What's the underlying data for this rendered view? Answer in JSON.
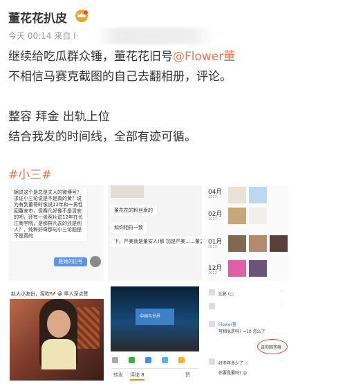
{
  "post": {
    "username": "董花花扒皮",
    "time": "今天 00:14",
    "source_prefix": "来自 I·",
    "lines": [
      "继续给吃瓜群众锤，董花花旧号",
      "不相信马赛克截图的自己去翻相册，评论。",
      "整容  拜金  出轨上位",
      "结合我发的时间线，全部有迹可循。"
    ],
    "mention": "@Flower董",
    "hashtag": "#小三#"
  },
  "images": {
    "chat": {
      "bubble_text": "据说这个是总是夫人的微博号？求证小三论说是不是真的黄？说为有到董哥时像说12年和一男性回董安市，但赛凡好像不是清安的吧，还有一张照片说12年在长江商学院，是那群凡去的还是别人？，纯粹好奇那句小三论题是不是真的",
      "reply": "是她的旧号"
    },
    "tile2": {
      "chip1": "董花花的粉丝发的",
      "chip2": "和你相符一致",
      "chip3": "下。严美就是董安人!那 加是严美……董之的"
    },
    "album": {
      "months": [
        "04月",
        "02月",
        "01月",
        "12月"
      ],
      "years": [
        "2013",
        "2013",
        "2013",
        "2012"
      ]
    },
    "photo_caption": "赵大小友份，挥吹🐶 😀 早人深点赞",
    "conference": {
      "screen_text": "中国与世界",
      "tabs": [
        "转发",
        "评论 8",
        "赞"
      ]
    },
    "comments": {
      "names": [
        "Flower董"
      ],
      "highlight": "该你回答哦",
      "texts": [
        "比影 (▢",
        "可相似是吗? ≈10 怎么了",
        "好多年多少了 ♡",
        "你要是要吗? ☺"
      ]
    }
  },
  "colors": {
    "accent": "#eb7350",
    "link": "#eb7350",
    "reply_bubble": "#5b93e6",
    "highlight_circle": "#e23b2e"
  },
  "icons": [
    "crown-icon"
  ]
}
